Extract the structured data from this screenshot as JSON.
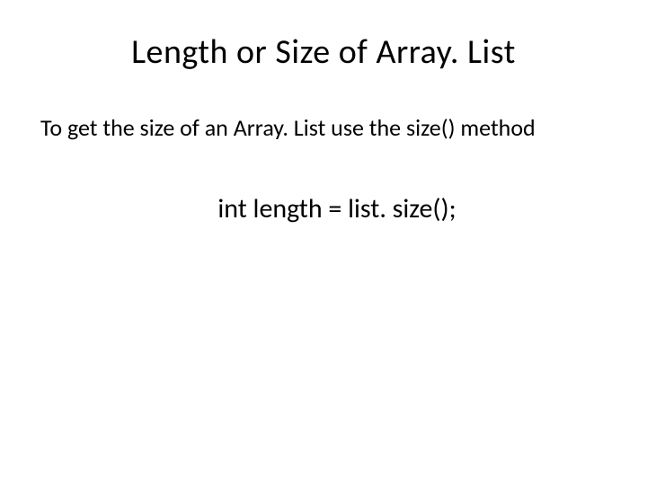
{
  "slide": {
    "title": "Length or Size of Array. List",
    "body": "To get the size of an Array. List use the size() method",
    "code": "int length = list. size();"
  }
}
